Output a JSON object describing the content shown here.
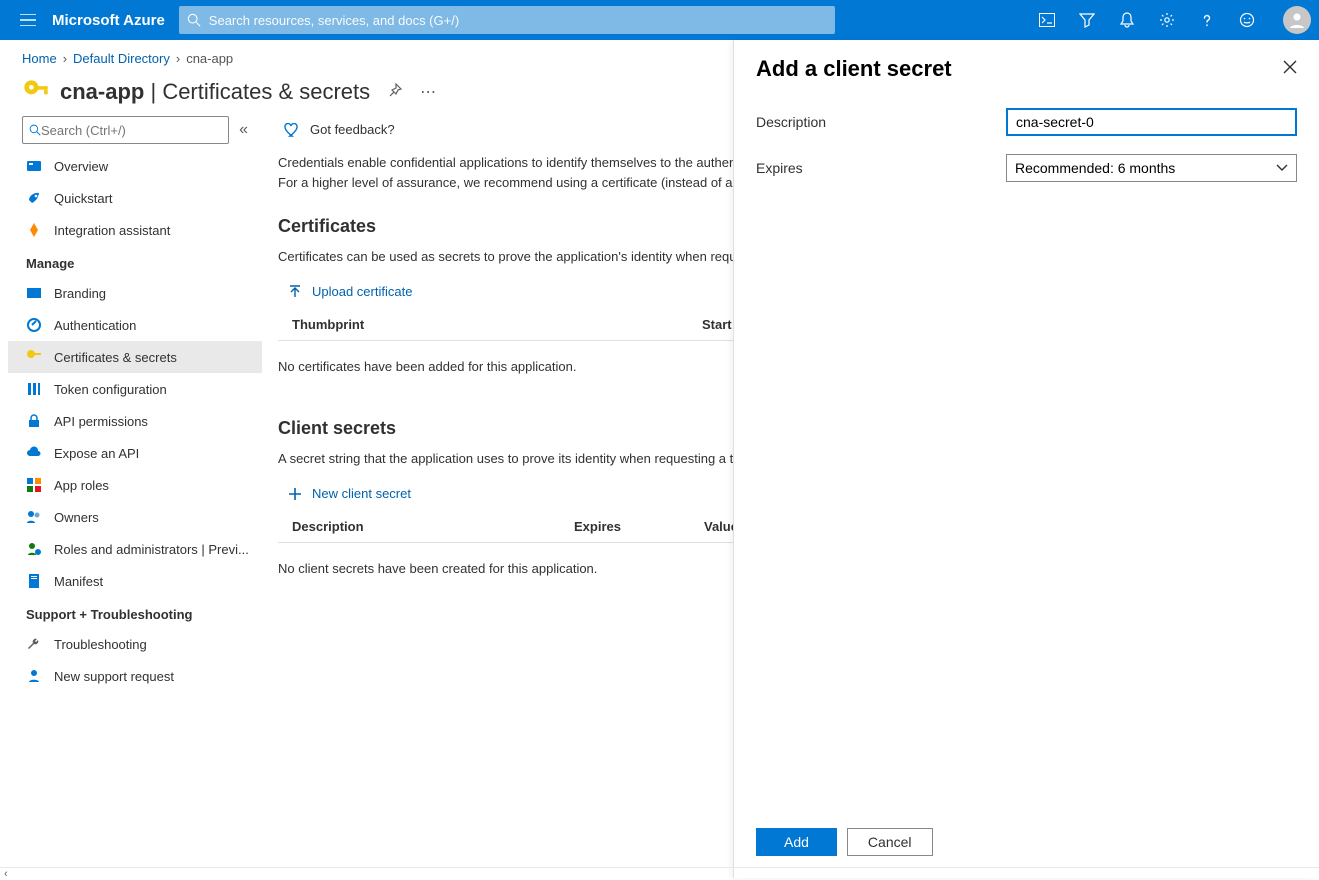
{
  "topbar": {
    "brand": "Microsoft Azure",
    "search_placeholder": "Search resources, services, and docs (G+/)"
  },
  "breadcrumb": {
    "items": [
      "Home",
      "Default Directory",
      "cna-app"
    ]
  },
  "page": {
    "app_name": "cna-app",
    "section_title": "Certificates & secrets"
  },
  "sidebar": {
    "search_placeholder": "Search (Ctrl+/)",
    "items_top": [
      {
        "label": "Overview"
      },
      {
        "label": "Quickstart"
      },
      {
        "label": "Integration assistant"
      }
    ],
    "group1": "Manage",
    "items_manage": [
      {
        "label": "Branding"
      },
      {
        "label": "Authentication"
      },
      {
        "label": "Certificates & secrets",
        "selected": true
      },
      {
        "label": "Token configuration"
      },
      {
        "label": "API permissions"
      },
      {
        "label": "Expose an API"
      },
      {
        "label": "App roles"
      },
      {
        "label": "Owners"
      },
      {
        "label": "Roles and administrators | Previ..."
      },
      {
        "label": "Manifest"
      }
    ],
    "group2": "Support + Troubleshooting",
    "items_support": [
      {
        "label": "Troubleshooting"
      },
      {
        "label": "New support request"
      }
    ]
  },
  "main": {
    "feedback": "Got feedback?",
    "intro": "Credentials enable confidential applications to identify themselves to the authentication service when receiving tokens at a web addressable location (using an HTTPS scheme). For a higher level of assurance, we recommend using a certificate (instead of a client secret) as a credential.",
    "cert_heading": "Certificates",
    "cert_desc": "Certificates can be used as secrets to prove the application's identity when requesting a token. Also can be referred to as public keys.",
    "upload_cert": "Upload certificate",
    "cert_cols": {
      "c1": "Thumbprint",
      "c2": "Start date"
    },
    "cert_empty": "No certificates have been added for this application.",
    "secret_heading": "Client secrets",
    "secret_desc": "A secret string that the application uses to prove its identity when requesting a token. Also can be referred to as application password.",
    "new_secret": "New client secret",
    "secret_cols": {
      "c1": "Description",
      "c2": "Expires",
      "c3": "Value"
    },
    "secret_empty": "No client secrets have been created for this application."
  },
  "flyout": {
    "title": "Add a client secret",
    "desc_label": "Description",
    "desc_value": "cna-secret-0",
    "expires_label": "Expires",
    "expires_value": "Recommended: 6 months",
    "add": "Add",
    "cancel": "Cancel"
  }
}
